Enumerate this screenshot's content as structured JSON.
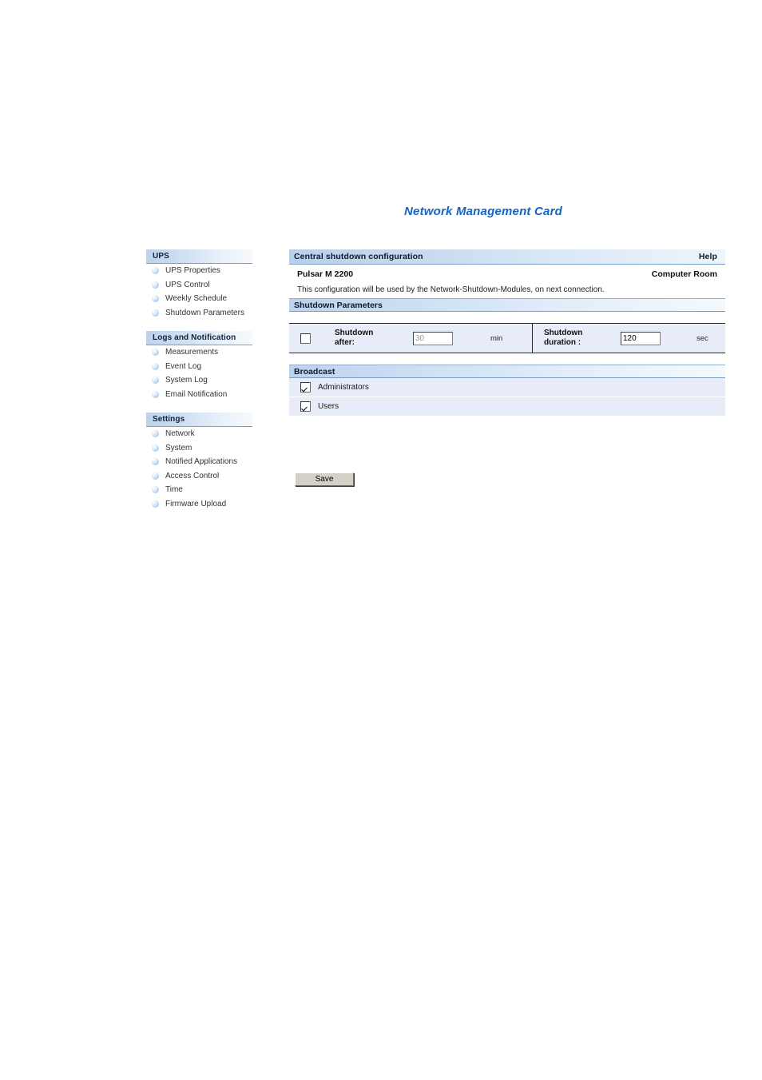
{
  "page": {
    "title": "Network Management Card"
  },
  "sidebar": {
    "groups": [
      {
        "header": "UPS",
        "items": [
          {
            "label": "UPS Properties",
            "icon": "sphere-bullet-icon"
          },
          {
            "label": "UPS Control",
            "icon": "sphere-bullet-icon"
          },
          {
            "label": "Weekly Schedule",
            "icon": "sphere-bullet-icon"
          },
          {
            "label": "Shutdown Parameters",
            "icon": "sphere-bullet-icon"
          }
        ]
      },
      {
        "header": "Logs and Notification",
        "items": [
          {
            "label": "Measurements",
            "icon": "sphere-bullet-icon"
          },
          {
            "label": "Event Log",
            "icon": "sphere-bullet-icon"
          },
          {
            "label": "System Log",
            "icon": "sphere-bullet-icon"
          },
          {
            "label": "Email Notification",
            "icon": "sphere-bullet-icon"
          }
        ]
      },
      {
        "header": "Settings",
        "items": [
          {
            "label": "Network",
            "icon": "sphere-bullet-icon"
          },
          {
            "label": "System",
            "icon": "sphere-bullet-icon"
          },
          {
            "label": "Notified Applications",
            "icon": "sphere-bullet-icon"
          },
          {
            "label": "Access Control",
            "icon": "sphere-bullet-icon"
          },
          {
            "label": "Time",
            "icon": "sphere-bullet-icon"
          },
          {
            "label": "Firmware Upload",
            "icon": "sphere-bullet-icon"
          }
        ]
      }
    ]
  },
  "panel": {
    "title": "Central shutdown configuration",
    "help_label": "Help",
    "device_name": "Pulsar M 2200",
    "location": "Computer Room",
    "description": "This configuration will be used by the Network-Shutdown-Modules, on next connection."
  },
  "shutdown_parameters": {
    "section_title": "Shutdown Parameters",
    "shutdown_after": {
      "enabled_checkbox_checked": false,
      "label": "Shutdown after:",
      "label_line1": "Shutdown",
      "label_line2": "after:",
      "value": "30",
      "unit": "min",
      "disabled": true
    },
    "shutdown_duration": {
      "label": "Shutdown duration :",
      "label_line1": "Shutdown",
      "label_line2": "duration :",
      "value": "120",
      "unit": "sec",
      "disabled": false
    }
  },
  "broadcast": {
    "section_title": "Broadcast",
    "options": [
      {
        "label": "Administrators",
        "checked": true
      },
      {
        "label": "Users",
        "checked": true
      }
    ]
  },
  "actions": {
    "save_label": "Save"
  },
  "colors": {
    "brand_blue": "#1763bf",
    "header_gradient_start": "#bcd2ec",
    "row_background": "#e8ecf9",
    "button_face": "#d4d0c8"
  }
}
